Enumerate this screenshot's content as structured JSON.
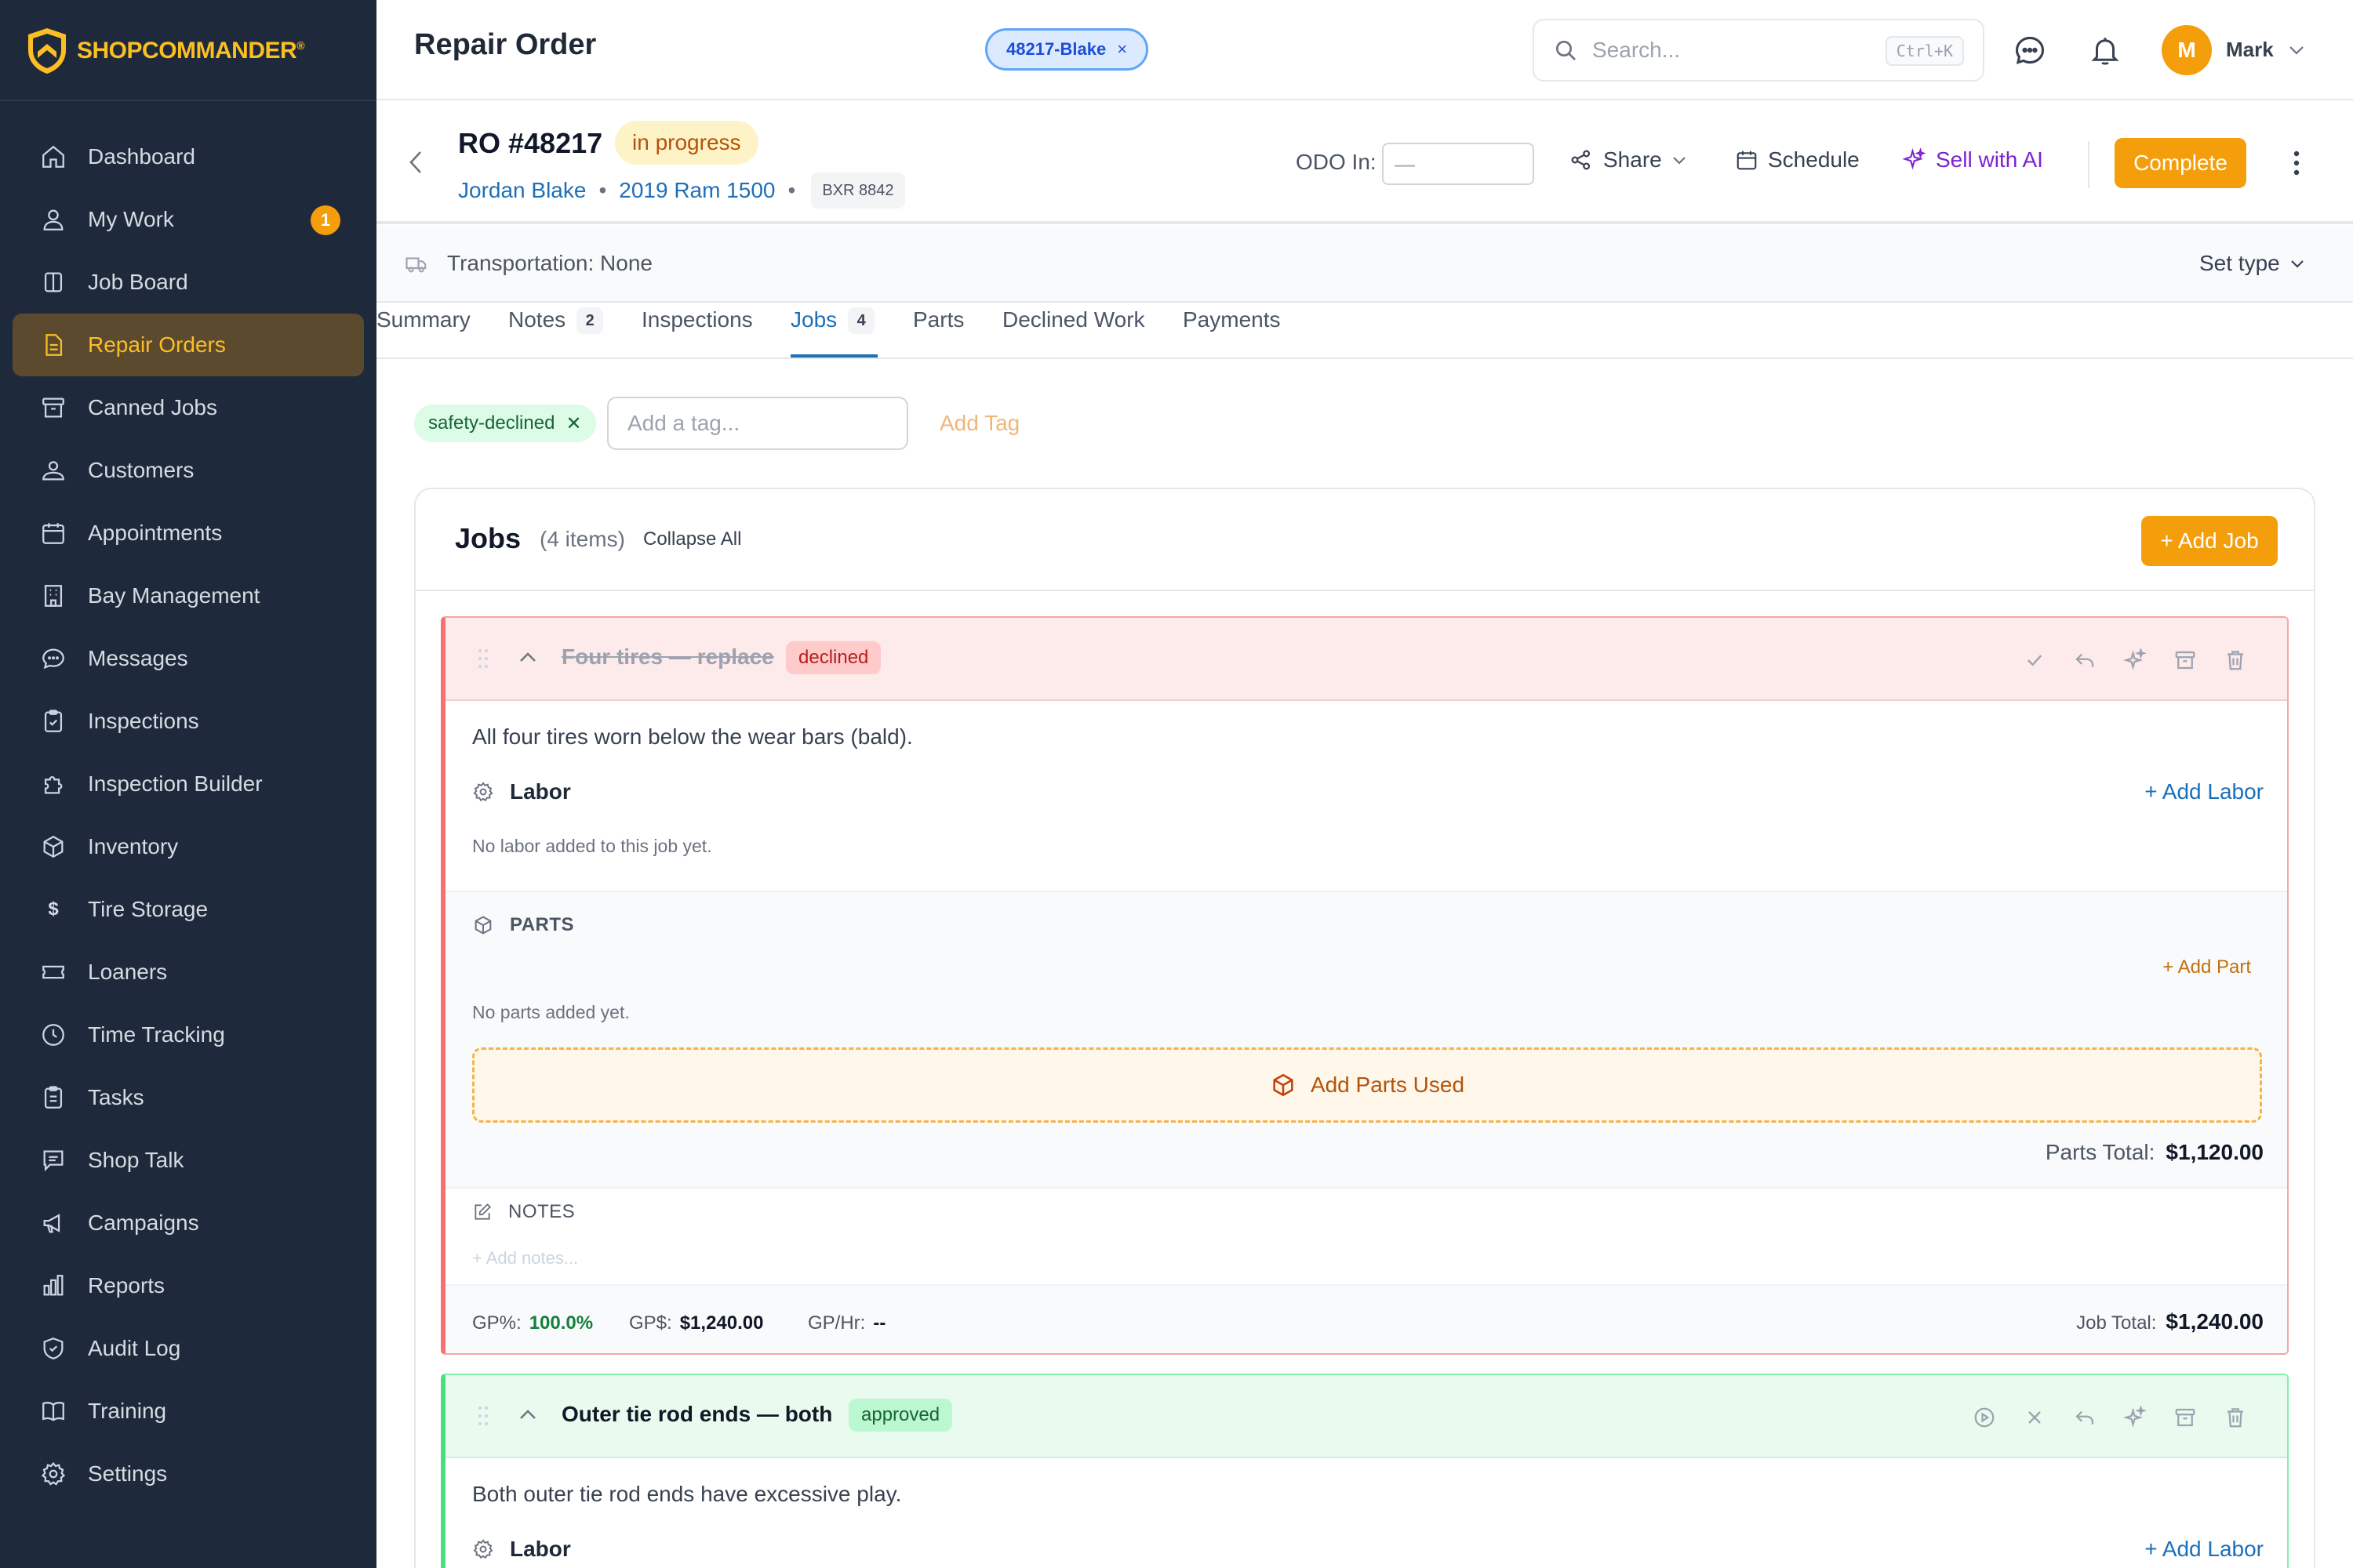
{
  "brand": {
    "shop": "SHOP",
    "commander": "COMMANDER",
    "reg": "®"
  },
  "sidebar": {
    "items": [
      {
        "label": "Dashboard",
        "icon": "home-icon"
      },
      {
        "label": "My Work",
        "icon": "user-icon",
        "badge": "1"
      },
      {
        "label": "Job Board",
        "icon": "columns-icon"
      },
      {
        "label": "Repair Orders",
        "icon": "document-icon",
        "active": true
      },
      {
        "label": "Canned Jobs",
        "icon": "archive-icon"
      },
      {
        "label": "Customers",
        "icon": "users-icon"
      },
      {
        "label": "Appointments",
        "icon": "calendar-icon"
      },
      {
        "label": "Bay Management",
        "icon": "building-icon"
      },
      {
        "label": "Messages",
        "icon": "chat-icon"
      },
      {
        "label": "Inspections",
        "icon": "clipboard-check-icon"
      },
      {
        "label": "Inspection Builder",
        "icon": "puzzle-icon"
      },
      {
        "label": "Inventory",
        "icon": "box-icon"
      },
      {
        "label": "Tire Storage",
        "icon": "dollar-icon"
      },
      {
        "label": "Loaners",
        "icon": "ticket-icon"
      },
      {
        "label": "Time Tracking",
        "icon": "clock-icon"
      },
      {
        "label": "Tasks",
        "icon": "clipboard-list-icon"
      },
      {
        "label": "Shop Talk",
        "icon": "message-square-icon"
      },
      {
        "label": "Campaigns",
        "icon": "megaphone-icon"
      },
      {
        "label": "Reports",
        "icon": "bar-chart-icon"
      },
      {
        "label": "Audit Log",
        "icon": "shield-check-icon"
      },
      {
        "label": "Training",
        "icon": "book-icon"
      },
      {
        "label": "Settings",
        "icon": "gear-icon"
      }
    ]
  },
  "header": {
    "title": "Repair Order",
    "ro_chip": "48217-Blake",
    "search_placeholder": "Search...",
    "search_shortcut": "Ctrl+K",
    "user_initial": "M",
    "user_name": "Mark"
  },
  "ro": {
    "number": "RO #48217",
    "status": "in progress",
    "customer": "Jordan Blake",
    "vehicle": "2019 Ram 1500",
    "plate": "BXR 8842",
    "odo_label": "ODO In:",
    "odo_placeholder": "—",
    "actions": {
      "share": "Share",
      "schedule": "Schedule",
      "sell_ai": "Sell with AI",
      "complete": "Complete"
    }
  },
  "transport": {
    "label": "Transportation: None",
    "set_type": "Set type"
  },
  "tabs": [
    {
      "label": "Summary"
    },
    {
      "label": "Notes",
      "count": "2"
    },
    {
      "label": "Inspections"
    },
    {
      "label": "Jobs",
      "count": "4",
      "active": true
    },
    {
      "label": "Parts"
    },
    {
      "label": "Declined Work"
    },
    {
      "label": "Payments"
    }
  ],
  "tags": {
    "chip": "safety-declined",
    "input_placeholder": "Add a tag...",
    "add_label": "Add Tag"
  },
  "jobs": {
    "title": "Jobs",
    "count_label": "(4 items)",
    "collapse_all": "Collapse All",
    "add_job": "+ Add Job",
    "items": [
      {
        "title": "Four tires — replace",
        "status": "declined",
        "description": "All four tires worn below the wear bars (bald).",
        "labor_heading": "Labor",
        "add_labor": "+ Add Labor",
        "no_labor": "No labor added to this job yet.",
        "parts_heading": "PARTS",
        "add_part": "+ Add Part",
        "no_parts": "No parts added yet.",
        "add_parts_used": "Add Parts Used",
        "parts_total_label": "Parts Total:",
        "parts_total": "$1,120.00",
        "notes_heading": "NOTES",
        "notes_placeholder": "+ Add notes...",
        "gp_pct_label": "GP%:",
        "gp_pct": "100.0%",
        "gp_dollar_label": "GP$:",
        "gp_dollar": "$1,240.00",
        "gp_hr_label": "GP/Hr:",
        "gp_hr": "--",
        "job_total_label": "Job Total:",
        "job_total": "$1,240.00"
      },
      {
        "title": "Outer tie rod ends — both",
        "status": "approved",
        "description": "Both outer tie rod ends have excessive play.",
        "labor_heading": "Labor",
        "add_labor": "+ Add Labor"
      }
    ]
  },
  "colors": {
    "sidebar_bg": "#1e2a3b",
    "accent": "#f59e0b",
    "link": "#1d6fb8",
    "declined": "#f87171",
    "approved": "#4ade80"
  }
}
